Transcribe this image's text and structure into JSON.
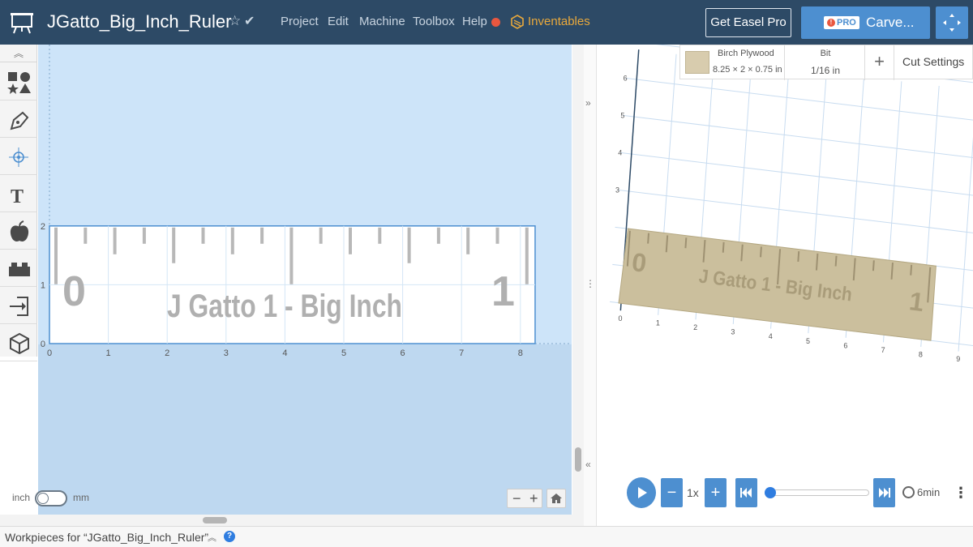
{
  "header": {
    "project_title": "JGatto_Big_Inch_Ruler",
    "menu": [
      "Project",
      "Edit",
      "Machine",
      "Toolbox",
      "Help"
    ],
    "inventables_label": "Inventables",
    "get_pro_label": "Get Easel Pro",
    "pro_badge": "PRO",
    "carve_label": "Carve..."
  },
  "toolbar": {
    "items": [
      "shapes-icon",
      "pen-icon",
      "point-icon",
      "text-icon",
      "apple-icon",
      "lego-icon",
      "import-icon",
      "cube-icon"
    ]
  },
  "canvas": {
    "x_ticks": [
      "0",
      "1",
      "2",
      "3",
      "4",
      "5",
      "6",
      "7",
      "8"
    ],
    "y_ticks": [
      "0",
      "1",
      "2"
    ],
    "ruler_left_digit": "0",
    "ruler_right_digit": "1",
    "ruler_text": "J Gatto 1 - Big Inch",
    "unit_inch": "inch",
    "unit_mm": "mm"
  },
  "material": {
    "name": "Birch Plywood",
    "dims": "8.25 × 2 × 0.75 in",
    "bit_label": "Bit",
    "bit_value": "1/16 in",
    "cut_settings": "Cut Settings"
  },
  "preview": {
    "x_ticks": [
      "0",
      "1",
      "2",
      "3",
      "4",
      "5",
      "6",
      "7",
      "8",
      "9"
    ],
    "y_ticks": [
      "3",
      "4",
      "5",
      "6"
    ]
  },
  "playback": {
    "speed": "1x",
    "progress": 0,
    "duration": "6min"
  },
  "footer": {
    "workpieces_label": "Workpieces for “JGatto_Big_Inch_Ruler”"
  }
}
